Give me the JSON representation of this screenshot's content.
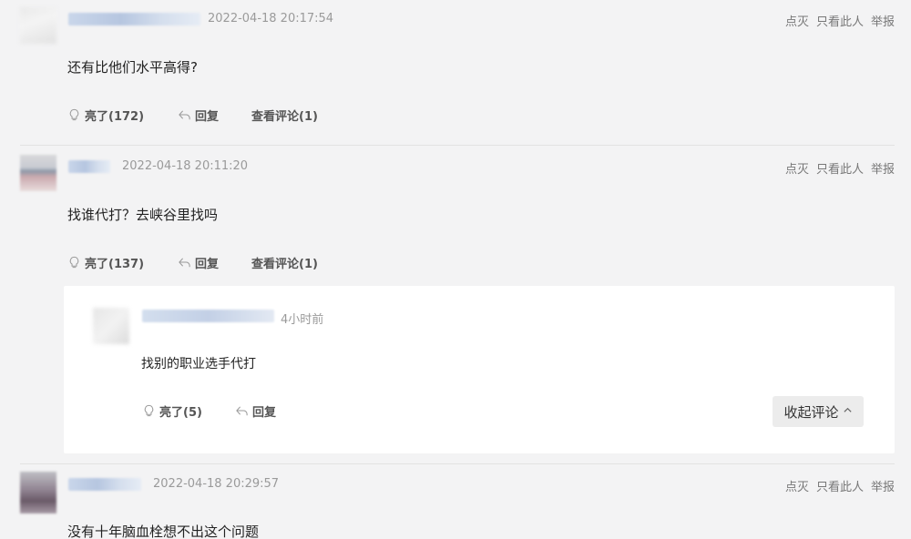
{
  "posts": [
    {
      "time": "2022-04-18 20:17:54",
      "actions": {
        "downvote": "点灭",
        "only_this": "只看此人",
        "report": "举报"
      },
      "content": "还有比他们水平高得?",
      "like_label": "亮了(172)",
      "reply_label": "回复",
      "view_comments": "查看评论(1)"
    },
    {
      "time": "2022-04-18 20:11:20",
      "actions": {
        "downvote": "点灭",
        "only_this": "只看此人",
        "report": "举报"
      },
      "content": "找谁代打？去峡谷里找吗",
      "like_label": "亮了(137)",
      "reply_label": "回复",
      "view_comments": "查看评论(1)"
    },
    {
      "time": "2022-04-18 20:29:57",
      "actions": {
        "downvote": "点灭",
        "only_this": "只看此人",
        "report": "举报"
      },
      "content": "没有十年脑血栓想不出这个问题"
    }
  ],
  "reply": {
    "time": "4小时前",
    "content": "找别的职业选手代打",
    "like_label": "亮了(5)",
    "reply_label": "回复",
    "collapse_label": "收起评论"
  },
  "icons": {
    "like": "lightbulb-icon",
    "reply": "reply-arrow-icon",
    "collapse": "chevron-up-icon"
  }
}
